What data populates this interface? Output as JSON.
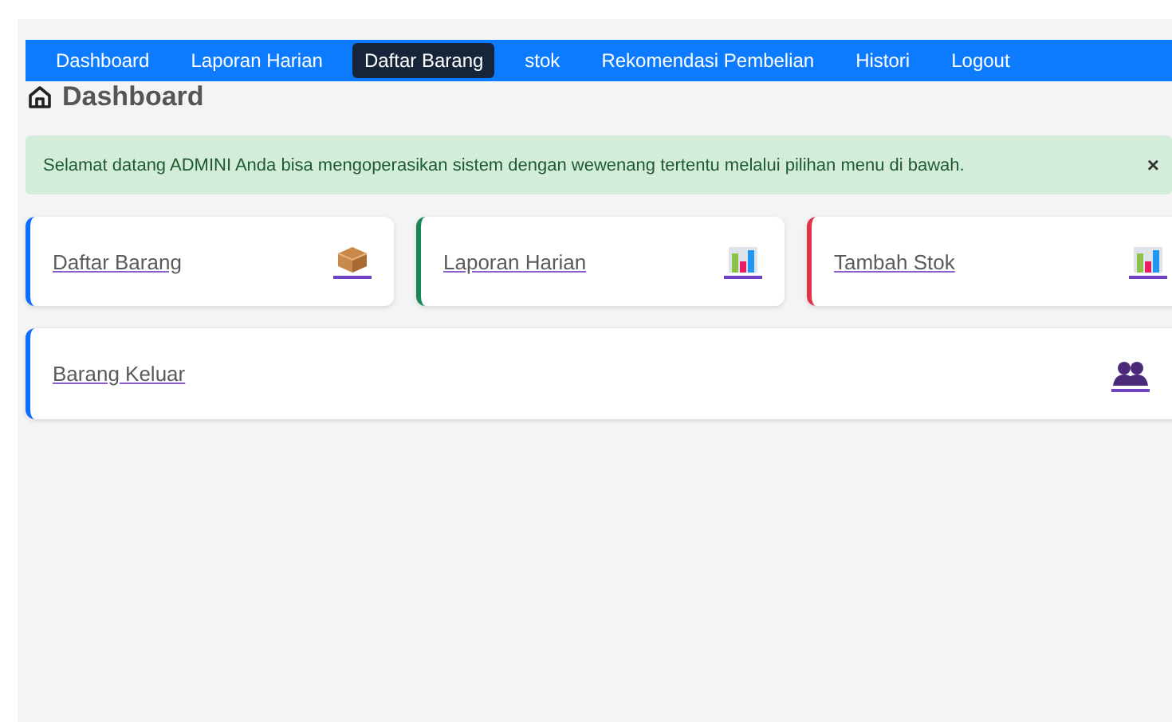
{
  "nav": [
    {
      "label": "Dashboard",
      "selected": false
    },
    {
      "label": "Laporan Harian",
      "selected": false
    },
    {
      "label": "Daftar Barang",
      "selected": true
    },
    {
      "label": "stok",
      "selected": false
    },
    {
      "label": "Rekomendasi Pembelian",
      "selected": false
    },
    {
      "label": "Histori",
      "selected": false
    },
    {
      "label": "Logout",
      "selected": false
    }
  ],
  "page_title": "Dashboard",
  "alert": {
    "message": "Selamat datang ADMINI Anda bisa mengoperasikan sistem dengan wewenang tertentu melalui pilihan menu di bawah.",
    "close": "×"
  },
  "cards": [
    {
      "label": "Daftar Barang",
      "color": "#0d6efd",
      "kind": "box"
    },
    {
      "label": "Laporan Harian",
      "color": "#198754",
      "kind": "chart"
    },
    {
      "label": "Tambah Stok",
      "color": "#dc3545",
      "kind": "chart"
    },
    {
      "label": "Barang Keluar",
      "color": "#0d6efd",
      "kind": "people"
    }
  ]
}
